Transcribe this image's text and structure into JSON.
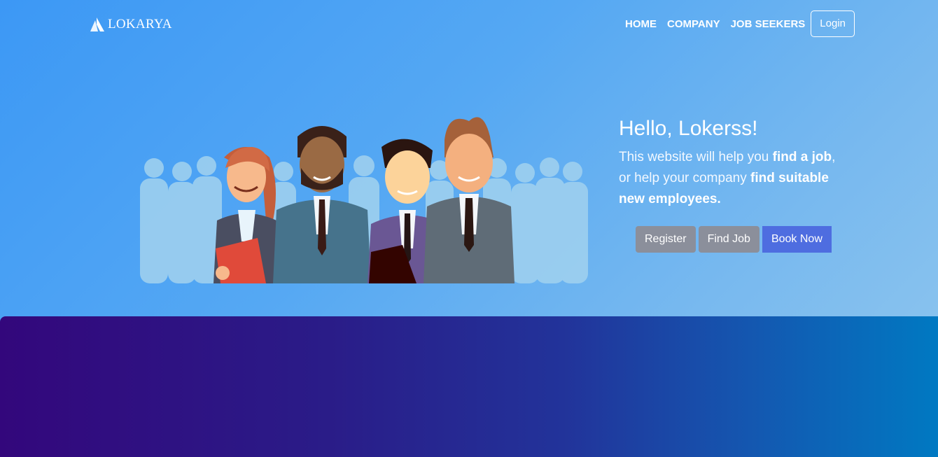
{
  "brand": {
    "name": "LOKARYA",
    "icon": "mountain-logo-icon"
  },
  "nav": {
    "items": [
      "HOME",
      "COMPANY",
      "JOB SEEKERS"
    ],
    "login": "Login"
  },
  "hero": {
    "title": "Hello, Lokerss!",
    "text_1": "This website will help you ",
    "bold_1": "find a job",
    "text_2": ",",
    "text_3": "or help your company ",
    "bold_2": "find suitable",
    "bold_3": "new employees."
  },
  "buttons": {
    "register": "Register",
    "find_job": "Find Job",
    "book_now": "Book Now"
  },
  "colors": {
    "hero_gradient_start": "#3c98f5",
    "hero_gradient_end": "#88c2ee",
    "band_gradient_start": "#33077c",
    "band_gradient_end": "#0079c2",
    "button_grey": "#8b8f9b",
    "button_blue": "#4e6de0"
  }
}
